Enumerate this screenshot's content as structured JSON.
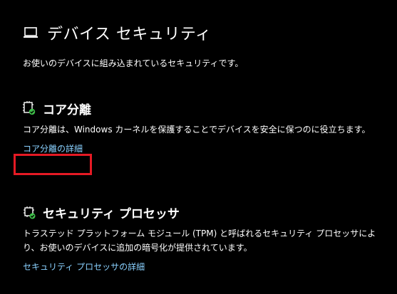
{
  "header": {
    "icon": "laptop-icon",
    "title": "デバイス セキュリティ",
    "description": "お使いのデバイスに組み込まれているセキュリティです。"
  },
  "sections": [
    {
      "icon": "core-isolation-chip-check-icon",
      "title": "コア分離",
      "description": "コア分離は、Windows カーネルを保護することでデバイスを安全に保つのに役立ちます。",
      "link": "コア分離の詳細"
    },
    {
      "icon": "security-processor-chip-check-icon",
      "title": "セキュリティ プロセッサ",
      "description": "トラステッド プラットフォーム モジュール (TPM) と呼ばれるセキュリティ プロセッサにより、お使いのデバイスに追加の暗号化が提供されています。",
      "link": "セキュリティ プロセッサの詳細"
    }
  ],
  "colors": {
    "background": "#000000",
    "text": "#ffffff",
    "link": "#8ad1ff",
    "check": "#3fbf4a",
    "highlight": "#e51a24"
  }
}
